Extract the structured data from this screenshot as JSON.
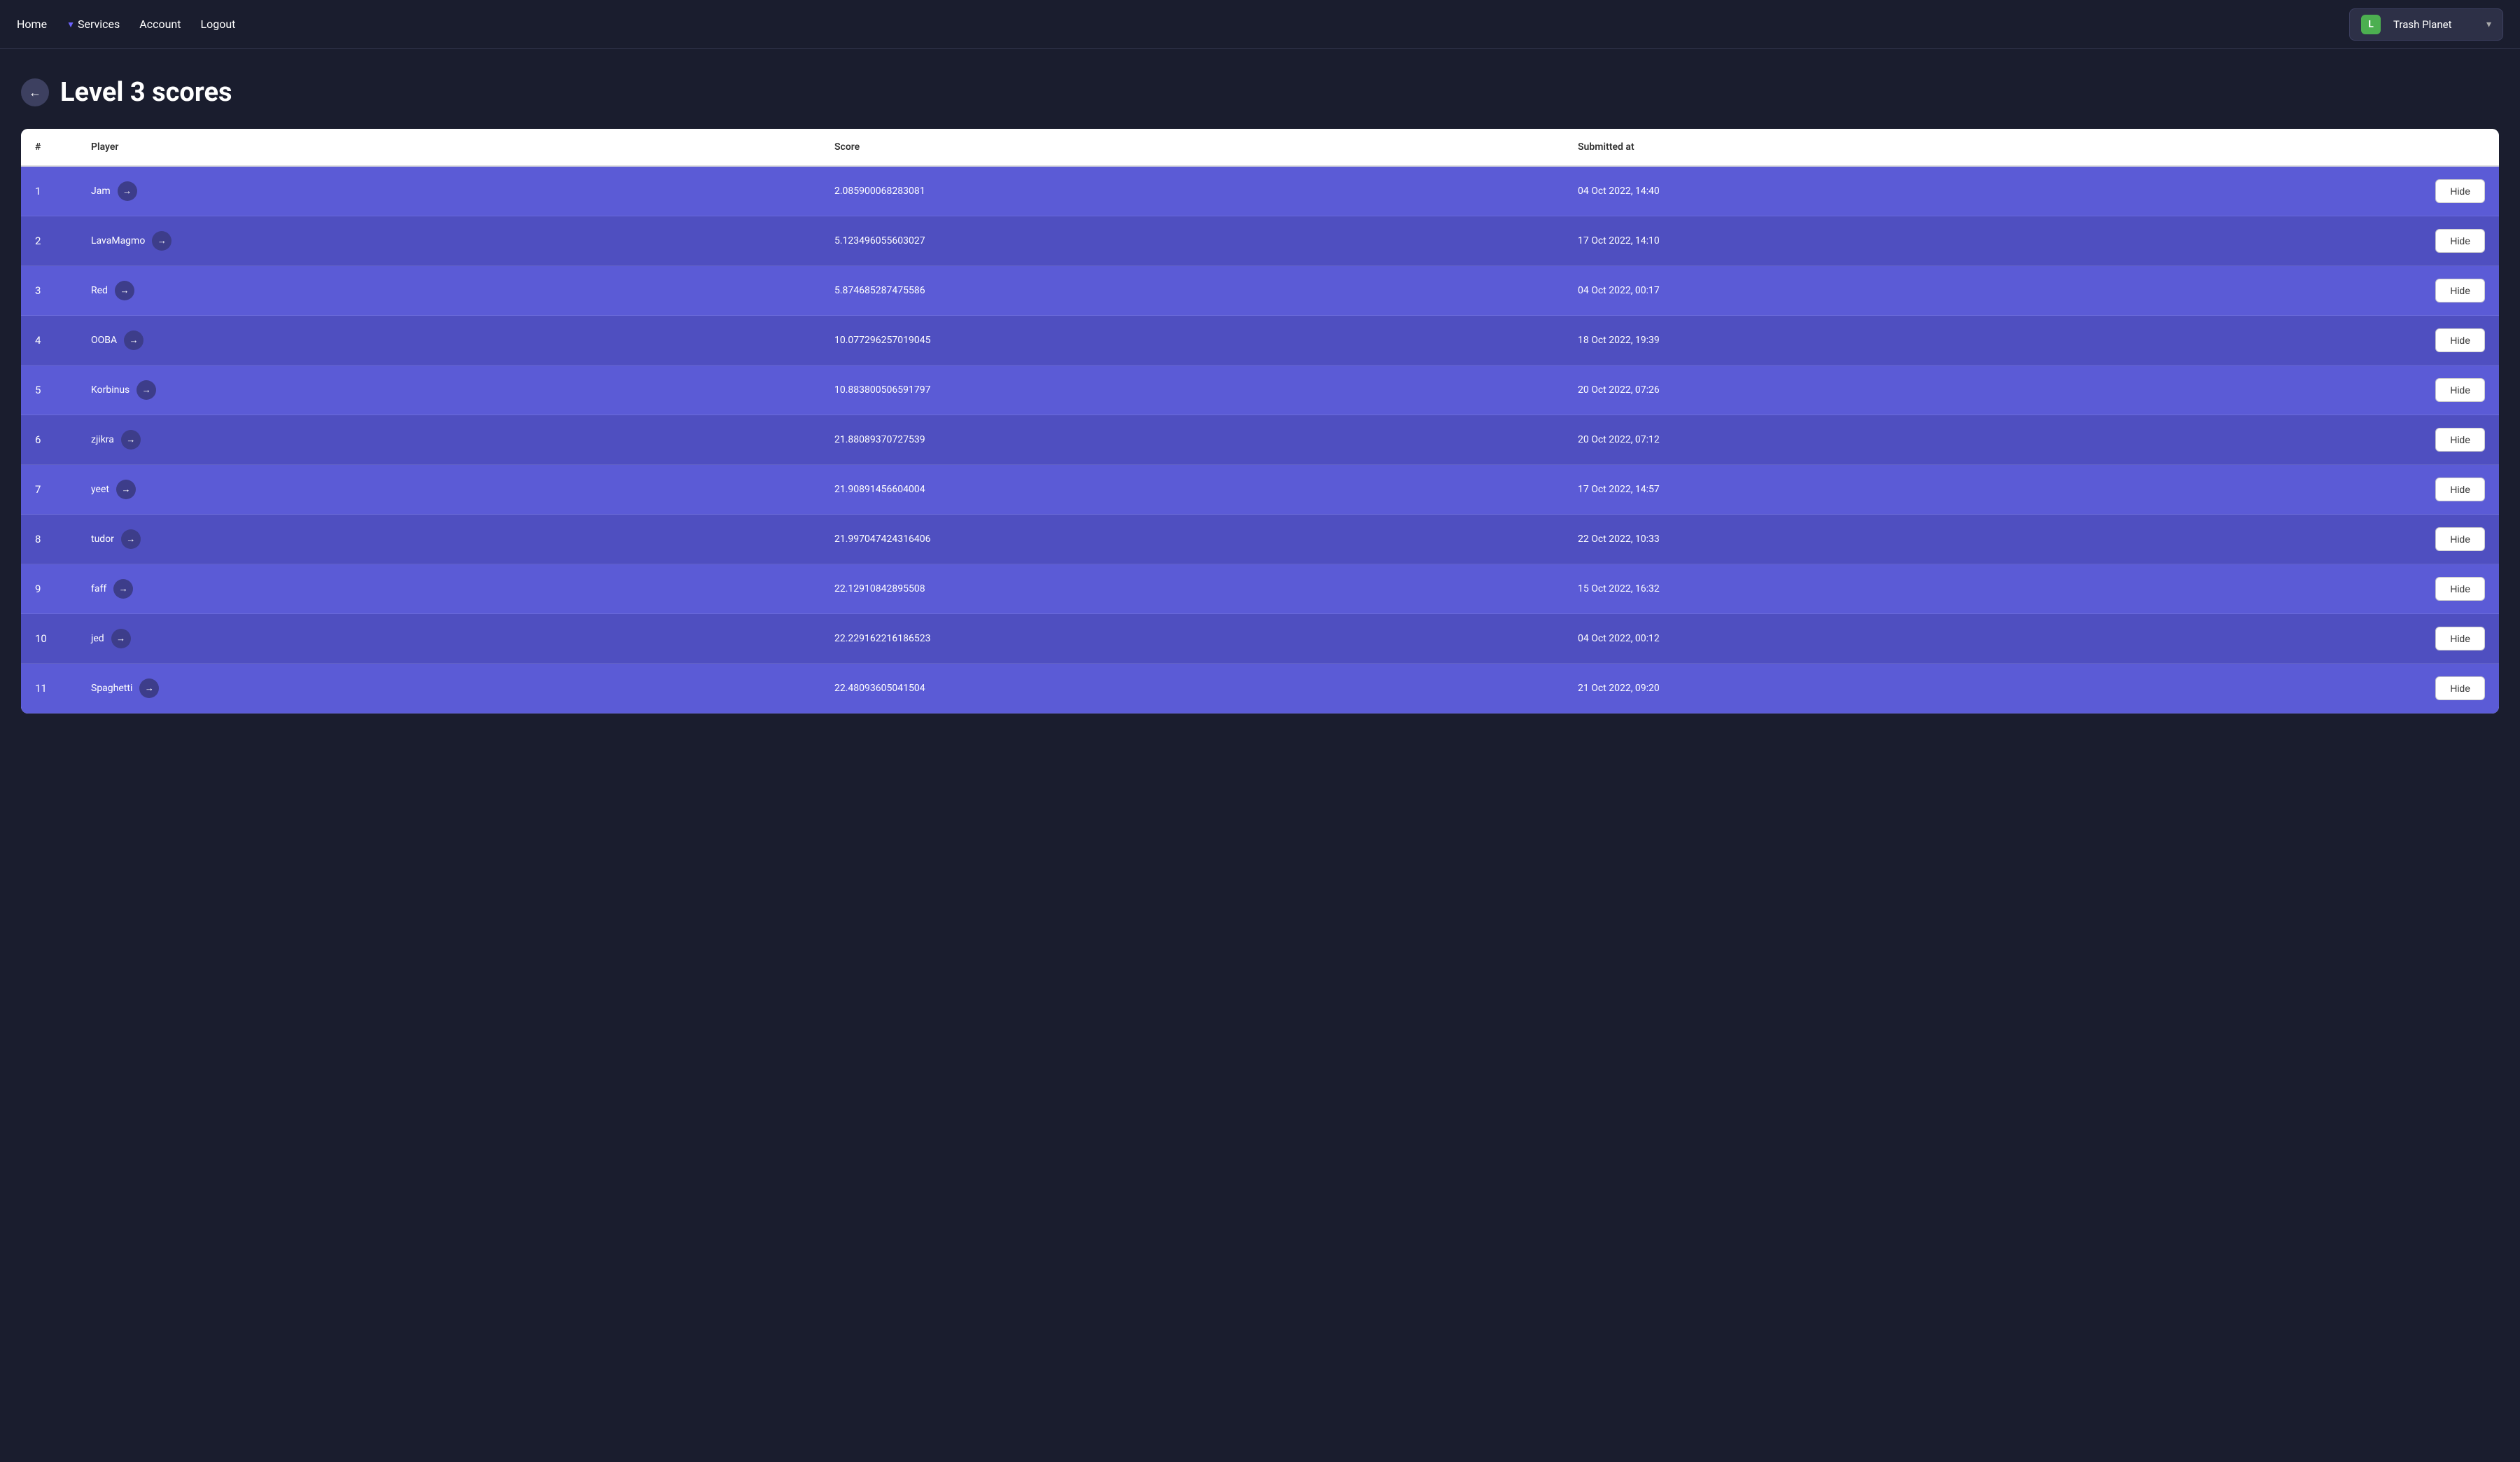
{
  "navbar": {
    "home_label": "Home",
    "services_label": "Services",
    "account_label": "Account",
    "logout_label": "Logout",
    "workspace": {
      "icon_letter": "L",
      "name": "Trash Planet"
    }
  },
  "page": {
    "title": "Level 3 scores",
    "back_label": "←"
  },
  "table": {
    "columns": {
      "rank": "#",
      "player": "Player",
      "score": "Score",
      "submitted_at": "Submitted at"
    },
    "rows": [
      {
        "rank": "1",
        "player": "Jam",
        "score": "2.085900068283081",
        "submitted_at": "04 Oct 2022, 14:40"
      },
      {
        "rank": "2",
        "player": "LavaMagmo",
        "score": "5.123496055603027",
        "submitted_at": "17 Oct 2022, 14:10"
      },
      {
        "rank": "3",
        "player": "Red",
        "score": "5.874685287475586",
        "submitted_at": "04 Oct 2022, 00:17"
      },
      {
        "rank": "4",
        "player": "OOBA",
        "score": "10.077296257019045",
        "submitted_at": "18 Oct 2022, 19:39"
      },
      {
        "rank": "5",
        "player": "Korbinus",
        "score": "10.883800506591797",
        "submitted_at": "20 Oct 2022, 07:26"
      },
      {
        "rank": "6",
        "player": "zjikra",
        "score": "21.88089370727539",
        "submitted_at": "20 Oct 2022, 07:12"
      },
      {
        "rank": "7",
        "player": "yeet",
        "score": "21.90891456604004",
        "submitted_at": "17 Oct 2022, 14:57"
      },
      {
        "rank": "8",
        "player": "tudor",
        "score": "21.997047424316406",
        "submitted_at": "22 Oct 2022, 10:33"
      },
      {
        "rank": "9",
        "player": "faff",
        "score": "22.12910842895508",
        "submitted_at": "15 Oct 2022, 16:32"
      },
      {
        "rank": "10",
        "player": "jed",
        "score": "22.229162216186523",
        "submitted_at": "04 Oct 2022, 00:12"
      },
      {
        "rank": "11",
        "player": "Spaghetti",
        "score": "22.48093605041504",
        "submitted_at": "21 Oct 2022, 09:20"
      }
    ],
    "hide_label": "Hide"
  }
}
